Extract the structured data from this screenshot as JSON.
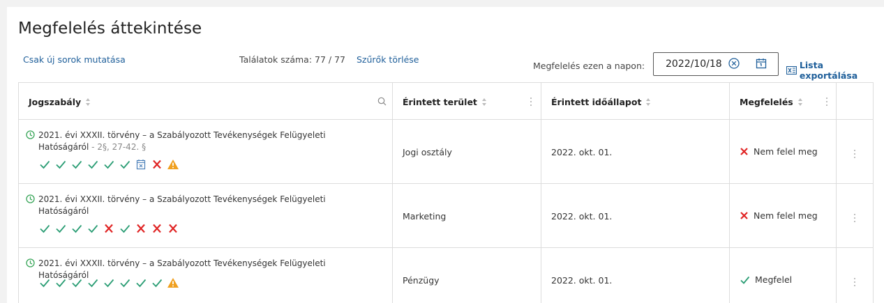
{
  "page": {
    "title": "Megfelelés áttekintése"
  },
  "toolbar": {
    "only_new": "Csak új sorok mutatása",
    "results": "Találatok száma: 77 / 77",
    "clear_filters": "Szűrők törlése",
    "date_label": "Megfelelés ezen a napon:",
    "date_value": "2022/10/18",
    "export_label": "Lista exportálása"
  },
  "table": {
    "columns": [
      {
        "label": "Jogszabály"
      },
      {
        "label": "Érintett terület"
      },
      {
        "label": "Érintett időállapot"
      },
      {
        "label": "Megfelelés"
      }
    ],
    "rows": [
      {
        "law_line1": "2021. évi XXXII. törvény – a Szabályozott Tevékenységek Felügyeleti",
        "law_line2": "Hatóságáról",
        "law_section": " - 2§, 27-42. §",
        "marks": [
          "check",
          "check",
          "check",
          "check",
          "check",
          "check",
          "calendar",
          "cross",
          "warning"
        ],
        "area": "Jogi osztály",
        "state": "2022. okt. 01.",
        "status": "Nem felel meg",
        "status_type": "fail"
      },
      {
        "law_line1": "2021. évi XXXII. törvény – a Szabályozott Tevékenységek Felügyeleti",
        "law_line2": "Hatóságáról",
        "law_section": "",
        "marks": [
          "check",
          "check",
          "check",
          "check",
          "cross",
          "check",
          "cross",
          "cross",
          "cross"
        ],
        "area": "Marketing",
        "state": "2022. okt. 01.",
        "status": "Nem felel meg",
        "status_type": "fail"
      },
      {
        "law_line1": "2021. évi XXXII. törvény – a Szabályozott Tevékenységek Felügyeleti",
        "law_line2": "Hatóságáról",
        "law_section": "",
        "marks": [
          "check",
          "check",
          "check",
          "check",
          "check",
          "check",
          "check",
          "check",
          "warning"
        ],
        "area": "Pénzügy",
        "state": "2022. okt. 01.",
        "status": "Megfelel",
        "status_type": "pass"
      }
    ]
  },
  "colors": {
    "check": "#2a9d74",
    "cross": "#e02424",
    "warning": "#f0a020",
    "calendar": "#4a7fb8",
    "clock": "#3aa65a",
    "link": "#1f5f9a"
  }
}
